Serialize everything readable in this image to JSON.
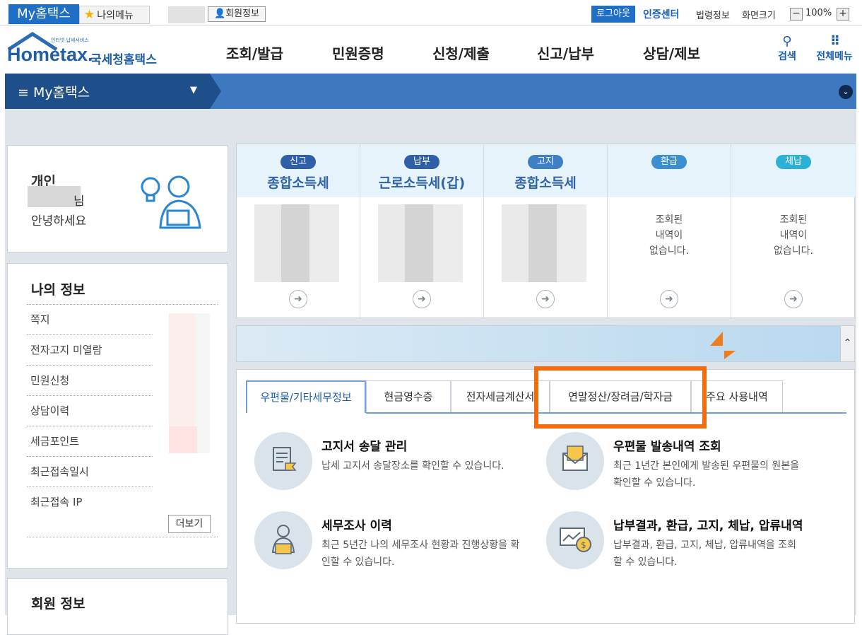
{
  "utility": {
    "tab_myhometax": "My홈택스",
    "tab_mymenu": "나의메뉴",
    "member_info": "회원정보",
    "logout": "로그아웃",
    "cert_center": "인증센터",
    "law_info": "법령정보",
    "screen_size": "화면크기",
    "zoom_minus": "−",
    "zoom_value": "100%",
    "zoom_plus": "+"
  },
  "gnb": {
    "logo_small": "인터넷 납세서비스",
    "logo_main": "Hometax.",
    "logo_korean": "국세청홈택스",
    "menu": [
      "조회/발급",
      "민원증명",
      "신청/제출",
      "신고/납부",
      "상담/제보"
    ],
    "search": "검색",
    "all_menu": "전체메뉴"
  },
  "subbar": {
    "title": "My홈택스"
  },
  "profile": {
    "type": "개인",
    "nim": "님",
    "greeting": "안녕하세요"
  },
  "myinfo": {
    "title": "나의 정보",
    "rows": [
      "쪽지",
      "전자고지 미열람",
      "민원신청",
      "상담이력",
      "세금포인트",
      "최근접속일시",
      "최근접속 IP"
    ],
    "more": "더보기"
  },
  "member": {
    "title": "회원 정보"
  },
  "summary": [
    {
      "badge": "신고",
      "name": "종합소득세",
      "badge_color": "#2f5fa8",
      "empty": ""
    },
    {
      "badge": "납부",
      "name": "근로소득세(갑)",
      "badge_color": "#2f5fa8",
      "empty": ""
    },
    {
      "badge": "고지",
      "name": "종합소득세",
      "badge_color": "#3f7fc4",
      "empty": ""
    },
    {
      "badge": "환급",
      "name": "",
      "badge_color": "#3a8fd0",
      "empty": "조회된\n내역이\n없습니다."
    },
    {
      "badge": "체납",
      "name": "",
      "badge_color": "#2bb0d8",
      "empty": "조회된\n내역이\n없습니다."
    }
  ],
  "tabs": [
    "우편물/기타세무정보",
    "현금영수증",
    "전자세금계산서",
    "연말정산/장려금/학자금",
    "주요 사용내역"
  ],
  "features": [
    {
      "title": "고지서 송달 관리",
      "desc": "납세 고지서 송달장소를 확인할 수 있습니다.",
      "icon": "document-icon"
    },
    {
      "title": "우편물 발송내역 조회",
      "desc": "최근 1년간 본인에게 발송된 우편물의 원본을 확인할 수 있습니다.",
      "icon": "envelope-icon"
    },
    {
      "title": "세무조사 이력",
      "desc": "최근 5년간 나의 세무조사 현황과 진행상황을 확인할 수 있습니다.",
      "icon": "person-laptop-icon"
    },
    {
      "title": "납부결과, 환급, 고지, 체납, 압류내역",
      "desc": "납부결과, 환급, 고지, 체납, 압류내역을 조회할 수 있습니다.",
      "icon": "monitor-coin-icon"
    }
  ],
  "colors": {
    "brand": "#1f6fc5",
    "highlight": "#f26b0f",
    "navy": "#1e4f8a"
  }
}
